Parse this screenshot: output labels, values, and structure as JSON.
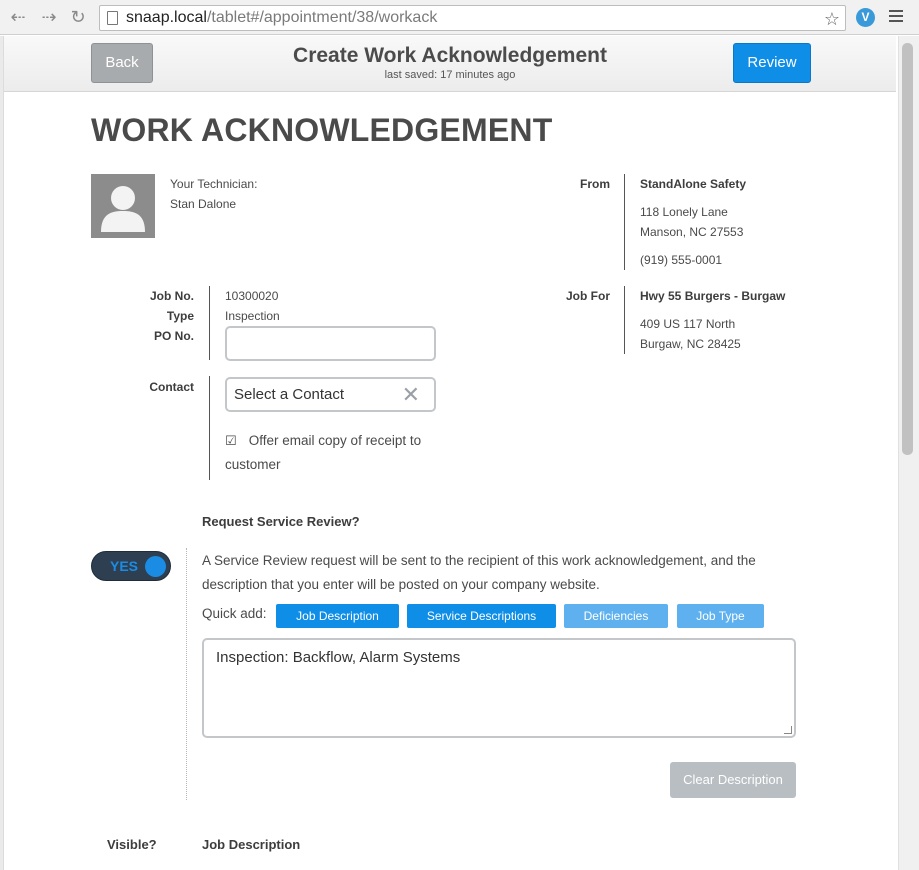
{
  "browser": {
    "url_host": "snaap.local",
    "url_path": "/tablet#/appointment/38/workack"
  },
  "header": {
    "back_label": "Back",
    "title": "Create Work Acknowledgement",
    "saved": "last saved: 17 minutes ago",
    "review_label": "Review"
  },
  "page": {
    "title": "WORK ACKNOWLEDGEMENT"
  },
  "technician": {
    "label": "Your Technician:",
    "name": "Stan Dalone"
  },
  "from": {
    "label": "From",
    "company": "StandAlone Safety",
    "address1": "118 Lonely Lane",
    "address2": "Manson, NC 27553",
    "phone": "(919) 555-0001"
  },
  "job": {
    "job_no_label": "Job No.",
    "job_no": "10300020",
    "type_label": "Type",
    "type": "Inspection",
    "po_label": "PO No.",
    "po_value": ""
  },
  "job_for": {
    "label": "Job For",
    "name": "Hwy 55 Burgers - Burgaw",
    "address1": "409 US 117 North",
    "address2": "Burgaw, NC 28425"
  },
  "contact": {
    "label": "Contact",
    "select_value": "Select a Contact",
    "offer_line1": "Offer email copy of receipt to",
    "offer_line2": "customer",
    "offer_checked": true
  },
  "service_review": {
    "heading": "Request Service Review?",
    "toggle_label": "YES",
    "description_line1": "A Service Review request will be sent to the recipient of this work acknowledgement, and the",
    "description_line2": "description that you enter will be posted on your company website.",
    "quick_add_label": "Quick add:",
    "quick_add": [
      "Job Description",
      "Service Descriptions",
      "Deficiencies",
      "Job Type"
    ],
    "textarea_value": "Inspection: Backflow, Alarm Systems",
    "clear_label": "Clear Description"
  },
  "footer_row": {
    "visible_label": "Visible?",
    "job_description_label": "Job Description"
  },
  "colors": {
    "primary": "#0f8ee8",
    "primary_light": "#5eb1ee",
    "toggle_bg": "#2e3f52",
    "disabled": "#b9bec2"
  }
}
